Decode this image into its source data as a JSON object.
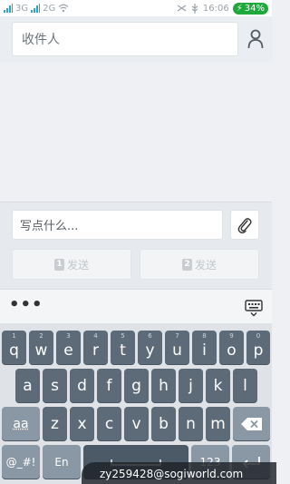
{
  "status_bar": {
    "sim1_label": "3G",
    "sim2_label": "2G",
    "time": "16:06",
    "battery": "34%"
  },
  "recipient": {
    "placeholder": "收件人"
  },
  "compose": {
    "placeholder": "写点什么...",
    "send1": {
      "sim": "1",
      "label": "发送"
    },
    "send2": {
      "sim": "2",
      "label": "发送"
    }
  },
  "keyboard": {
    "row1": [
      {
        "ch": "q",
        "hint": "1"
      },
      {
        "ch": "w",
        "hint": "2"
      },
      {
        "ch": "e",
        "hint": "3"
      },
      {
        "ch": "r",
        "hint": "4"
      },
      {
        "ch": "t",
        "hint": "5"
      },
      {
        "ch": "y",
        "hint": "6"
      },
      {
        "ch": "u",
        "hint": "7"
      },
      {
        "ch": "i",
        "hint": "8"
      },
      {
        "ch": "o",
        "hint": "9"
      },
      {
        "ch": "p",
        "hint": "0"
      }
    ],
    "row2": [
      "a",
      "s",
      "d",
      "f",
      "g",
      "h",
      "j",
      "k",
      "l"
    ],
    "row3": [
      "z",
      "x",
      "c",
      "v",
      "b",
      "n",
      "m"
    ],
    "shift_label": "aa",
    "symbols_label": "@_#!",
    "lang_label": "En",
    "num_label": "123"
  },
  "watermark": "zy259428@sogiworld.com",
  "icons": {
    "contact": "person-icon",
    "attach": "paperclip-icon",
    "more": "more-dots-icon",
    "hide_keyboard": "keyboard-hide-icon",
    "backspace": "backspace-icon",
    "enter": "enter-icon",
    "space": "space-icon"
  }
}
